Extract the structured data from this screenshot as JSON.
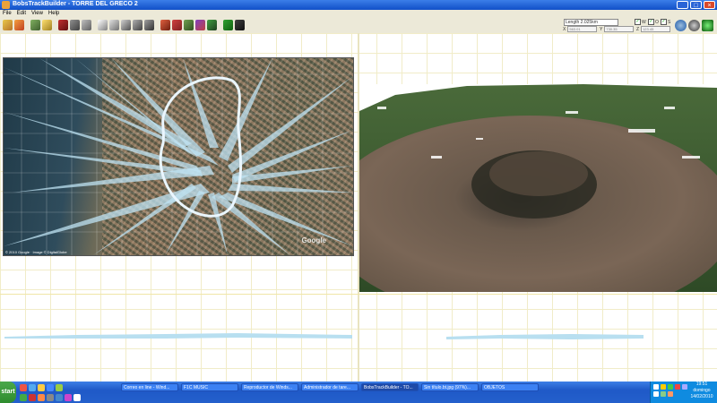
{
  "window": {
    "title": "BobsTrackBuilder - TORRE DEL GRECO 2"
  },
  "menu": {
    "items": [
      "File",
      "Edit",
      "View",
      "Help"
    ]
  },
  "toolbar": {
    "length_label": "Length 2.025km",
    "checks": [
      {
        "label": "W",
        "checked": true
      },
      {
        "label": "O",
        "checked": true
      },
      {
        "label": "S",
        "checked": true
      }
    ],
    "x_label": "X",
    "x_value": "563.01",
    "y_label": "Y",
    "y_value": "730.35",
    "z_label": "Z",
    "z_value": "123.45"
  },
  "map": {
    "copyright": "© 2010 Google · Image © DigitalGlobe",
    "logo": "Google"
  },
  "taskbar": {
    "start_label": "start",
    "tasks": [
      {
        "label": "Correo en line - Wind...",
        "active": false
      },
      {
        "label": "F1C MUSIC",
        "active": false
      },
      {
        "label": "Reproductor de Winds...",
        "active": false
      },
      {
        "label": "Administrador de tare...",
        "active": false
      },
      {
        "label": "BobsTrackBuilder - TO...",
        "active": true
      },
      {
        "label": "Sin título.bt.jpg (97%)...",
        "active": false
      },
      {
        "label": "OBJETOS",
        "active": false
      }
    ],
    "clock_time": "19:51",
    "clock_day": "domingo",
    "clock_date": "14/02/2010"
  },
  "colors": {
    "accent": "#1150c8",
    "route": "#b8dff0",
    "grid": "#f1ecc8"
  }
}
